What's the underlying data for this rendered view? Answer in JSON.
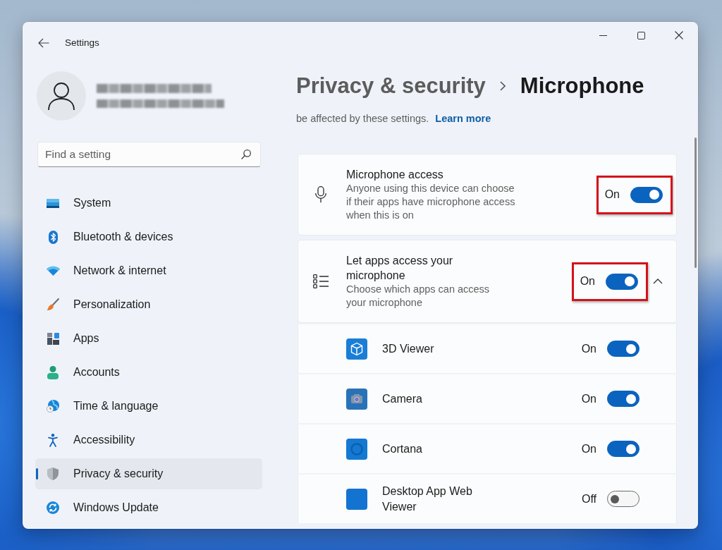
{
  "window": {
    "title": "Settings"
  },
  "search": {
    "placeholder": "Find a setting"
  },
  "sidebar": {
    "items": [
      {
        "label": "System",
        "selected": false
      },
      {
        "label": "Bluetooth & devices",
        "selected": false
      },
      {
        "label": "Network & internet",
        "selected": false
      },
      {
        "label": "Personalization",
        "selected": false
      },
      {
        "label": "Apps",
        "selected": false
      },
      {
        "label": "Accounts",
        "selected": false
      },
      {
        "label": "Time & language",
        "selected": false
      },
      {
        "label": "Accessibility",
        "selected": false
      },
      {
        "label": "Privacy & security",
        "selected": true
      },
      {
        "label": "Windows Update",
        "selected": false
      }
    ]
  },
  "breadcrumb": {
    "parent": "Privacy & security",
    "current": "Microphone"
  },
  "intro": {
    "text": "be affected by these settings.",
    "link": "Learn more"
  },
  "settings": [
    {
      "title": "Microphone access",
      "description": "Anyone using this device can choose if their apps have microphone access when this is on",
      "state": "On",
      "on": true,
      "highlighted": true
    },
    {
      "title": "Let apps access your microphone",
      "description": "Choose which apps can access your microphone",
      "state": "On",
      "on": true,
      "highlighted": true,
      "expanded": true,
      "apps": [
        {
          "name": "3D Viewer",
          "state": "On",
          "on": true
        },
        {
          "name": "Camera",
          "state": "On",
          "on": true
        },
        {
          "name": "Cortana",
          "state": "On",
          "on": true
        },
        {
          "name": "Desktop App Web Viewer",
          "state": "Off",
          "on": false
        }
      ]
    }
  ]
}
